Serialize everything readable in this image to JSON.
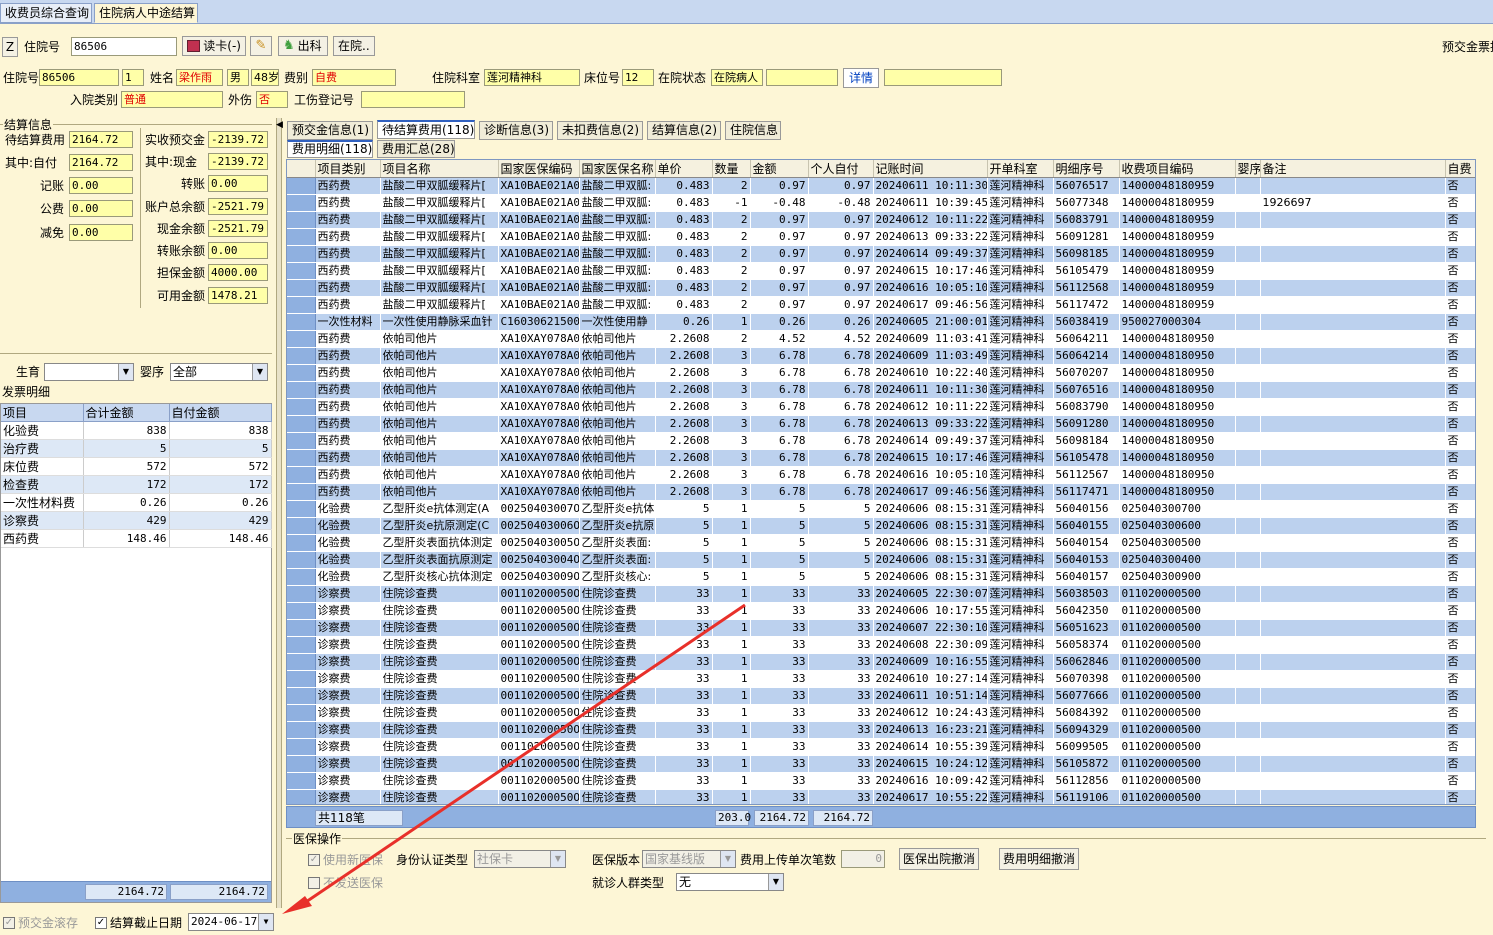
{
  "top_tabs": [
    "收费员综合查询",
    "住院病人中途结算"
  ],
  "toolbar": {
    "z_button": "Z",
    "admission_label": "住院号",
    "admission_value": "86506",
    "read_card": "读卡(-)",
    "discharge": "出科",
    "in_hospital": "在院..",
    "right_text": "预交金票据"
  },
  "patient": {
    "admission_label": "住院号",
    "admission_value": "86506",
    "times_value": "1",
    "name_label": "姓名",
    "name_value": "梁作雨",
    "sex_value": "男",
    "age_value": "48岁",
    "fee_type_label": "费别",
    "fee_type_value": "自费",
    "dept_label": "住院科室",
    "dept_value": "莲河精神科",
    "bed_label": "床位号",
    "bed_value": "12",
    "status_label": "在院状态",
    "status_value": "在院病人",
    "detail_link": "详情",
    "admit_type_label": "入院类别",
    "admit_type_value": "普通",
    "injury_label": "外伤",
    "injury_value": "否",
    "work_injury_label": "工伤登记号"
  },
  "settlement": {
    "title": "结算信息",
    "pending_label": "待结算费用",
    "pending_value": "2164.72",
    "selfpay_label": "其中:自付",
    "selfpay_value": "2164.72",
    "credit_label": "记账",
    "credit_value": "0.00",
    "public_label": "公费",
    "public_value": "0.00",
    "reduce_label": "减免",
    "reduce_value": "0.00",
    "actual_deposit_label": "实收预交金",
    "actual_deposit_value": "-2139.72",
    "cash_label": "其中:现金",
    "cash_value": "-2139.72",
    "transfer_label": "转账",
    "transfer_value": "0.00",
    "account_total_label": "账户总余额",
    "account_total_value": "-2521.79",
    "cash_balance_label": "现金余额",
    "cash_balance_value": "-2521.79",
    "transfer_balance_label": "转账余额",
    "transfer_balance_value": "0.00",
    "guarantee_label": "担保金额",
    "guarantee_value": "4000.00",
    "available_label": "可用金额",
    "available_value": "1478.21"
  },
  "filters": {
    "birth_label": "生育",
    "birth_value": "",
    "infant_label": "婴序",
    "infant_value": "全部"
  },
  "invoice": {
    "title": "发票明细",
    "columns": [
      "项目",
      "合计金额",
      "自付金额"
    ],
    "rows": [
      [
        "化验费",
        "838",
        "838"
      ],
      [
        "治疗费",
        "5",
        "5"
      ],
      [
        "床位费",
        "572",
        "572"
      ],
      [
        "检查费",
        "172",
        "172"
      ],
      [
        "一次性材料费",
        "0.26",
        "0.26"
      ],
      [
        "诊察费",
        "429",
        "429"
      ],
      [
        "西药费",
        "148.46",
        "148.46"
      ]
    ],
    "total_sum": "2164.72",
    "total_self": "2164.72"
  },
  "main_tabs": [
    "预交金信息(1)",
    "待结算费用(118)",
    "诊断信息(3)",
    "未扣费信息(2)",
    "结算信息(2)",
    "住院信息"
  ],
  "sub_tabs": [
    "费用明细(118)",
    "费用汇总(28)"
  ],
  "grid": {
    "columns": [
      "项目类别",
      "项目名称",
      "国家医保编码",
      "国家医保名称",
      "单价",
      "数量",
      "金额",
      "个人自付",
      "记账时间",
      "开单科室",
      "明细序号",
      "收费项目编码",
      "婴序",
      "备注",
      "自费"
    ],
    "rows": [
      [
        "西药费",
        "盐酸二甲双胍缓释片[",
        "XA10BAE021A01",
        "盐酸二甲双胍:",
        "0.483",
        "2",
        "0.97",
        "0.97",
        "20240611 10:11:30",
        "莲河精神科",
        "56076517",
        "14000048180959",
        "",
        "",
        "否"
      ],
      [
        "西药费",
        "盐酸二甲双胍缓释片[",
        "XA10BAE021A01",
        "盐酸二甲双胍:",
        "0.483",
        "-1",
        "-0.48",
        "-0.48",
        "20240611 10:39:45",
        "莲河精神科",
        "56077348",
        "14000048180959",
        "",
        "1926697",
        "否"
      ],
      [
        "西药费",
        "盐酸二甲双胍缓释片[",
        "XA10BAE021A01",
        "盐酸二甲双胍:",
        "0.483",
        "2",
        "0.97",
        "0.97",
        "20240612 10:11:22",
        "莲河精神科",
        "56083791",
        "14000048180959",
        "",
        "",
        "否"
      ],
      [
        "西药费",
        "盐酸二甲双胍缓释片[",
        "XA10BAE021A01",
        "盐酸二甲双胍:",
        "0.483",
        "2",
        "0.97",
        "0.97",
        "20240613 09:33:22",
        "莲河精神科",
        "56091281",
        "14000048180959",
        "",
        "",
        "否"
      ],
      [
        "西药费",
        "盐酸二甲双胍缓释片[",
        "XA10BAE021A01",
        "盐酸二甲双胍:",
        "0.483",
        "2",
        "0.97",
        "0.97",
        "20240614 09:49:37",
        "莲河精神科",
        "56098185",
        "14000048180959",
        "",
        "",
        "否"
      ],
      [
        "西药费",
        "盐酸二甲双胍缓释片[",
        "XA10BAE021A01",
        "盐酸二甲双胍:",
        "0.483",
        "2",
        "0.97",
        "0.97",
        "20240615 10:17:46",
        "莲河精神科",
        "56105479",
        "14000048180959",
        "",
        "",
        "否"
      ],
      [
        "西药费",
        "盐酸二甲双胍缓释片[",
        "XA10BAE021A01",
        "盐酸二甲双胍:",
        "0.483",
        "2",
        "0.97",
        "0.97",
        "20240616 10:05:10",
        "莲河精神科",
        "56112568",
        "14000048180959",
        "",
        "",
        "否"
      ],
      [
        "西药费",
        "盐酸二甲双胍缓释片[",
        "XA10BAE021A01",
        "盐酸二甲双胍:",
        "0.483",
        "2",
        "0.97",
        "0.97",
        "20240617 09:46:56",
        "莲河精神科",
        "56117472",
        "14000048180959",
        "",
        "",
        "否"
      ],
      [
        "一次性材料",
        "一次性使用静脉采血针",
        "C16030621500C",
        "一次性使用静",
        "0.26",
        "1",
        "0.26",
        "0.26",
        "20240605 21:00:01",
        "莲河精神科",
        "56038419",
        "950027000304",
        "",
        "",
        "否"
      ],
      [
        "西药费",
        "依帕司他片",
        "XA10XAY078A0C",
        "依帕司他片",
        "2.2608",
        "2",
        "4.52",
        "4.52",
        "20240609 11:03:41",
        "莲河精神科",
        "56064211",
        "14000048180950",
        "",
        "",
        "否"
      ],
      [
        "西药费",
        "依帕司他片",
        "XA10XAY078A0C",
        "依帕司他片",
        "2.2608",
        "3",
        "6.78",
        "6.78",
        "20240609 11:03:49",
        "莲河精神科",
        "56064214",
        "14000048180950",
        "",
        "",
        "否"
      ],
      [
        "西药费",
        "依帕司他片",
        "XA10XAY078A0C",
        "依帕司他片",
        "2.2608",
        "3",
        "6.78",
        "6.78",
        "20240610 10:22:40",
        "莲河精神科",
        "56070207",
        "14000048180950",
        "",
        "",
        "否"
      ],
      [
        "西药费",
        "依帕司他片",
        "XA10XAY078A0C",
        "依帕司他片",
        "2.2608",
        "3",
        "6.78",
        "6.78",
        "20240611 10:11:30",
        "莲河精神科",
        "56076516",
        "14000048180950",
        "",
        "",
        "否"
      ],
      [
        "西药费",
        "依帕司他片",
        "XA10XAY078A0C",
        "依帕司他片",
        "2.2608",
        "3",
        "6.78",
        "6.78",
        "20240612 10:11:22",
        "莲河精神科",
        "56083790",
        "14000048180950",
        "",
        "",
        "否"
      ],
      [
        "西药费",
        "依帕司他片",
        "XA10XAY078A0C",
        "依帕司他片",
        "2.2608",
        "3",
        "6.78",
        "6.78",
        "20240613 09:33:22",
        "莲河精神科",
        "56091280",
        "14000048180950",
        "",
        "",
        "否"
      ],
      [
        "西药费",
        "依帕司他片",
        "XA10XAY078A0C",
        "依帕司他片",
        "2.2608",
        "3",
        "6.78",
        "6.78",
        "20240614 09:49:37",
        "莲河精神科",
        "56098184",
        "14000048180950",
        "",
        "",
        "否"
      ],
      [
        "西药费",
        "依帕司他片",
        "XA10XAY078A0C",
        "依帕司他片",
        "2.2608",
        "3",
        "6.78",
        "6.78",
        "20240615 10:17:46",
        "莲河精神科",
        "56105478",
        "14000048180950",
        "",
        "",
        "否"
      ],
      [
        "西药费",
        "依帕司他片",
        "XA10XAY078A0C",
        "依帕司他片",
        "2.2608",
        "3",
        "6.78",
        "6.78",
        "20240616 10:05:10",
        "莲河精神科",
        "56112567",
        "14000048180950",
        "",
        "",
        "否"
      ],
      [
        "西药费",
        "依帕司他片",
        "XA10XAY078A0C",
        "依帕司他片",
        "2.2608",
        "3",
        "6.78",
        "6.78",
        "20240617 09:46:56",
        "莲河精神科",
        "56117471",
        "14000048180950",
        "",
        "",
        "否"
      ],
      [
        "化验费",
        "乙型肝炎e抗体测定(A",
        "00250403007OC",
        "乙型肝炎e抗体",
        "5",
        "1",
        "5",
        "5",
        "20240606 08:15:31",
        "莲河精神科",
        "56040156",
        "025040300700",
        "",
        "",
        "否"
      ],
      [
        "化验费",
        "乙型肝炎e抗原测定(C",
        "00250403006OC",
        "乙型肝炎e抗原",
        "5",
        "1",
        "5",
        "5",
        "20240606 08:15:31",
        "莲河精神科",
        "56040155",
        "025040300600",
        "",
        "",
        "否"
      ],
      [
        "化验费",
        "乙型肝炎表面抗体测定",
        "00250403005OC",
        "乙型肝炎表面:",
        "5",
        "1",
        "5",
        "5",
        "20240606 08:15:31",
        "莲河精神科",
        "56040154",
        "025040300500",
        "",
        "",
        "否"
      ],
      [
        "化验费",
        "乙型肝炎表面抗原测定",
        "00250403004OC",
        "乙型肝炎表面:",
        "5",
        "1",
        "5",
        "5",
        "20240606 08:15:31",
        "莲河精神科",
        "56040153",
        "025040300400",
        "",
        "",
        "否"
      ],
      [
        "化验费",
        "乙型肝炎核心抗体测定",
        "00250403009OC",
        "乙型肝炎核心:",
        "5",
        "1",
        "5",
        "5",
        "20240606 08:15:31",
        "莲河精神科",
        "56040157",
        "025040300900",
        "",
        "",
        "否"
      ],
      [
        "诊察费",
        "住院诊查费",
        "00110200050OC",
        "住院诊查费",
        "33",
        "1",
        "33",
        "33",
        "20240605 22:30:07",
        "莲河精神科",
        "56038503",
        "011020000500",
        "",
        "",
        "否"
      ],
      [
        "诊察费",
        "住院诊查费",
        "00110200050OC",
        "住院诊查费",
        "33",
        "1",
        "33",
        "33",
        "20240606 10:17:55",
        "莲河精神科",
        "56042350",
        "011020000500",
        "",
        "",
        "否"
      ],
      [
        "诊察费",
        "住院诊查费",
        "00110200050OC",
        "住院诊查费",
        "33",
        "1",
        "33",
        "33",
        "20240607 22:30:10",
        "莲河精神科",
        "56051623",
        "011020000500",
        "",
        "",
        "否"
      ],
      [
        "诊察费",
        "住院诊查费",
        "00110200050OC",
        "住院诊查费",
        "33",
        "1",
        "33",
        "33",
        "20240608 22:30:09",
        "莲河精神科",
        "56058374",
        "011020000500",
        "",
        "",
        "否"
      ],
      [
        "诊察费",
        "住院诊查费",
        "00110200050OC",
        "住院诊查费",
        "33",
        "1",
        "33",
        "33",
        "20240609 10:16:55",
        "莲河精神科",
        "56062846",
        "011020000500",
        "",
        "",
        "否"
      ],
      [
        "诊察费",
        "住院诊查费",
        "00110200050OC",
        "住院诊查费",
        "33",
        "1",
        "33",
        "33",
        "20240610 10:27:14",
        "莲河精神科",
        "56070398",
        "011020000500",
        "",
        "",
        "否"
      ],
      [
        "诊察费",
        "住院诊查费",
        "00110200050OC",
        "住院诊查费",
        "33",
        "1",
        "33",
        "33",
        "20240611 10:51:14",
        "莲河精神科",
        "56077666",
        "011020000500",
        "",
        "",
        "否"
      ],
      [
        "诊察费",
        "住院诊查费",
        "00110200050OC",
        "住院诊查费",
        "33",
        "1",
        "33",
        "33",
        "20240612 10:24:43",
        "莲河精神科",
        "56084392",
        "011020000500",
        "",
        "",
        "否"
      ],
      [
        "诊察费",
        "住院诊查费",
        "00110200050OC",
        "住院诊查费",
        "33",
        "1",
        "33",
        "33",
        "20240613 16:23:21",
        "莲河精神科",
        "56094329",
        "011020000500",
        "",
        "",
        "否"
      ],
      [
        "诊察费",
        "住院诊查费",
        "00110200050OC",
        "住院诊查费",
        "33",
        "1",
        "33",
        "33",
        "20240614 10:55:39",
        "莲河精神科",
        "56099505",
        "011020000500",
        "",
        "",
        "否"
      ],
      [
        "诊察费",
        "住院诊查费",
        "00110200050OC",
        "住院诊查费",
        "33",
        "1",
        "33",
        "33",
        "20240615 10:24:12",
        "莲河精神科",
        "56105872",
        "011020000500",
        "",
        "",
        "否"
      ],
      [
        "诊察费",
        "住院诊查费",
        "00110200050OC",
        "住院诊查费",
        "33",
        "1",
        "33",
        "33",
        "20240616 10:09:42",
        "莲河精神科",
        "56112856",
        "011020000500",
        "",
        "",
        "否"
      ],
      [
        "诊察费",
        "住院诊查费",
        "00110200050OC",
        "住院诊查费",
        "33",
        "1",
        "33",
        "33",
        "20240617 10:55:22",
        "莲河精神科",
        "56119106",
        "011020000500",
        "",
        "",
        "否"
      ]
    ],
    "footer_count": "共118笔",
    "footer_qty": "203.0",
    "footer_amount": "2164.72",
    "footer_self": "2164.72"
  },
  "insurance": {
    "title": "医保操作",
    "use_new": "使用新医保",
    "no_send": "不发送医保",
    "id_type_label": "身份认证类型",
    "id_type_value": "社保卡",
    "version_label": "医保版本",
    "version_value": "国家基线版",
    "upload_label": "费用上传单次笔数",
    "upload_value": "0",
    "cancel_discharge": "医保出院撤消",
    "cancel_detail": "费用明细撤消",
    "visitor_type_label": "就诊人群类型",
    "visitor_type_value": "无"
  },
  "bottom": {
    "deposit_roll": "预交金滚存",
    "settle_date_label": "结算截止日期",
    "settle_date_value": "2024-06-17"
  },
  "colors": {
    "accent": "#3060c0",
    "field": "#ffffa8",
    "row_alt": "#bcd1ee",
    "annotation_arrow": "#e8302a"
  }
}
